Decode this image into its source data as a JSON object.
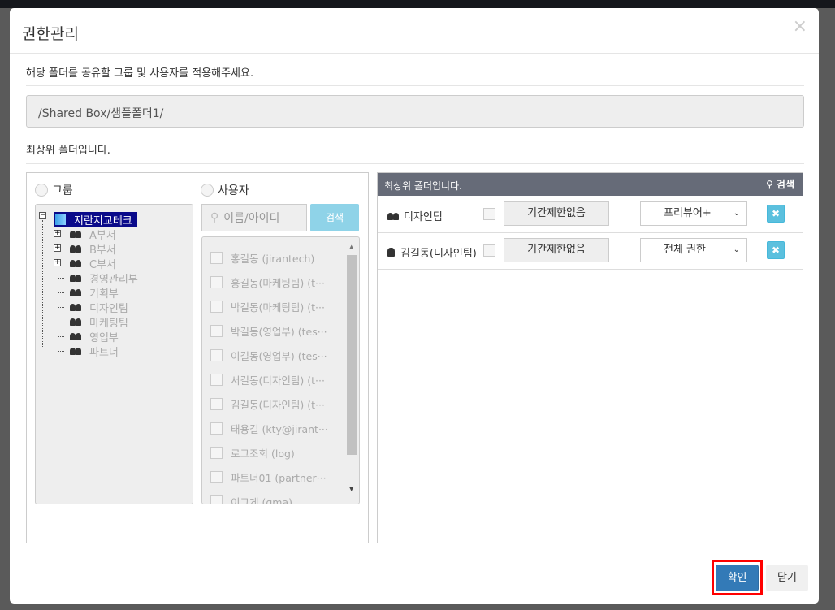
{
  "dialog": {
    "title": "권한관리",
    "close_icon": "×",
    "instruction": "해당 폴더를 공유할 그룹 및 사용자를 적용해주세요.",
    "path": "/Shared Box/샘플폴더1/",
    "top_note": "최상위 폴더입니다."
  },
  "left": {
    "group_radio": "그룹",
    "user_radio": "사용자",
    "tree": {
      "root": "지란지교테크",
      "children": [
        "A부서",
        "B부서",
        "C부서",
        "경영관리부",
        "기획부",
        "디자인팀",
        "마케팅팀",
        "영업부",
        "파트너"
      ]
    },
    "search_placeholder": "이름/아이디",
    "search_button": "검색",
    "users": [
      "홍길동 (jirantech)",
      "홍길동(마케팅팀) (t···",
      "박길동(마케팅팀) (t···",
      "박길동(영업부) (tes···",
      "이길동(영업부) (tes···",
      "서길동(디자인팀) (t···",
      "김길동(디자인팀) (t···",
      "태용길 (kty@jirant···",
      "로그조회 (log)",
      "파트너01 (partner···",
      "이그게 (gma)"
    ]
  },
  "right": {
    "header": "최상위 폴더입니다.",
    "search_label": "검색",
    "rows": [
      {
        "name": "디자인팀",
        "icon": "group-icon",
        "period": "기간제한없음",
        "permission": "프리뷰어+"
      },
      {
        "name": "김길동(디자인팀)",
        "icon": "user-icon",
        "period": "기간제한없음",
        "permission": "전체 권한"
      }
    ]
  },
  "footer": {
    "confirm": "확인",
    "close": "닫기"
  },
  "colors": {
    "confirm": "#337ab7",
    "highlight": "#ff0000",
    "panel_header": "#666b78",
    "search_button": "#8fd3e8"
  }
}
